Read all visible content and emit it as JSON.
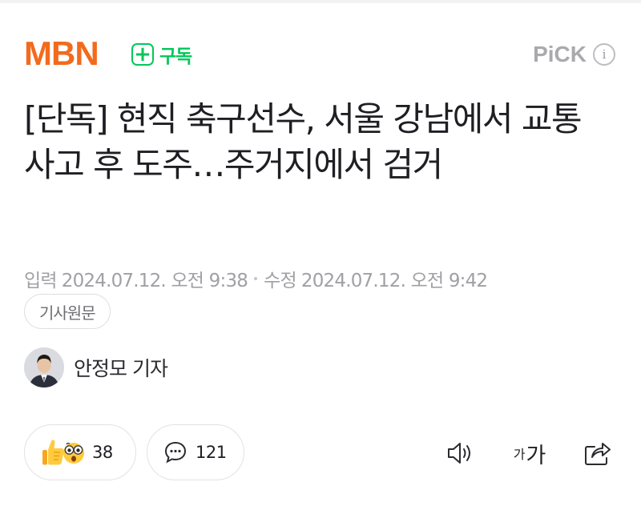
{
  "header": {
    "press_name": "MBN",
    "subscribe_label": "구독",
    "pick_label": "PiCK",
    "info_glyph": "i"
  },
  "article": {
    "title": "[단독] 현직 축구선수, 서울 강남에서 교통사고 후 도주…주거지에서 검거",
    "input_label": "입력",
    "input_date": "2024.07.12. 오전 9:38",
    "modified_label": "수정",
    "modified_date": "2024.07.12. 오전 9:42",
    "original_link_label": "기사원문"
  },
  "reporter": {
    "name": "안정모 기자"
  },
  "actions": {
    "reaction_count": "38",
    "comment_count": "121",
    "font_small": "가",
    "font_big": "가"
  },
  "colors": {
    "brand_orange": "#f26b1d",
    "naver_green": "#03c75a"
  }
}
